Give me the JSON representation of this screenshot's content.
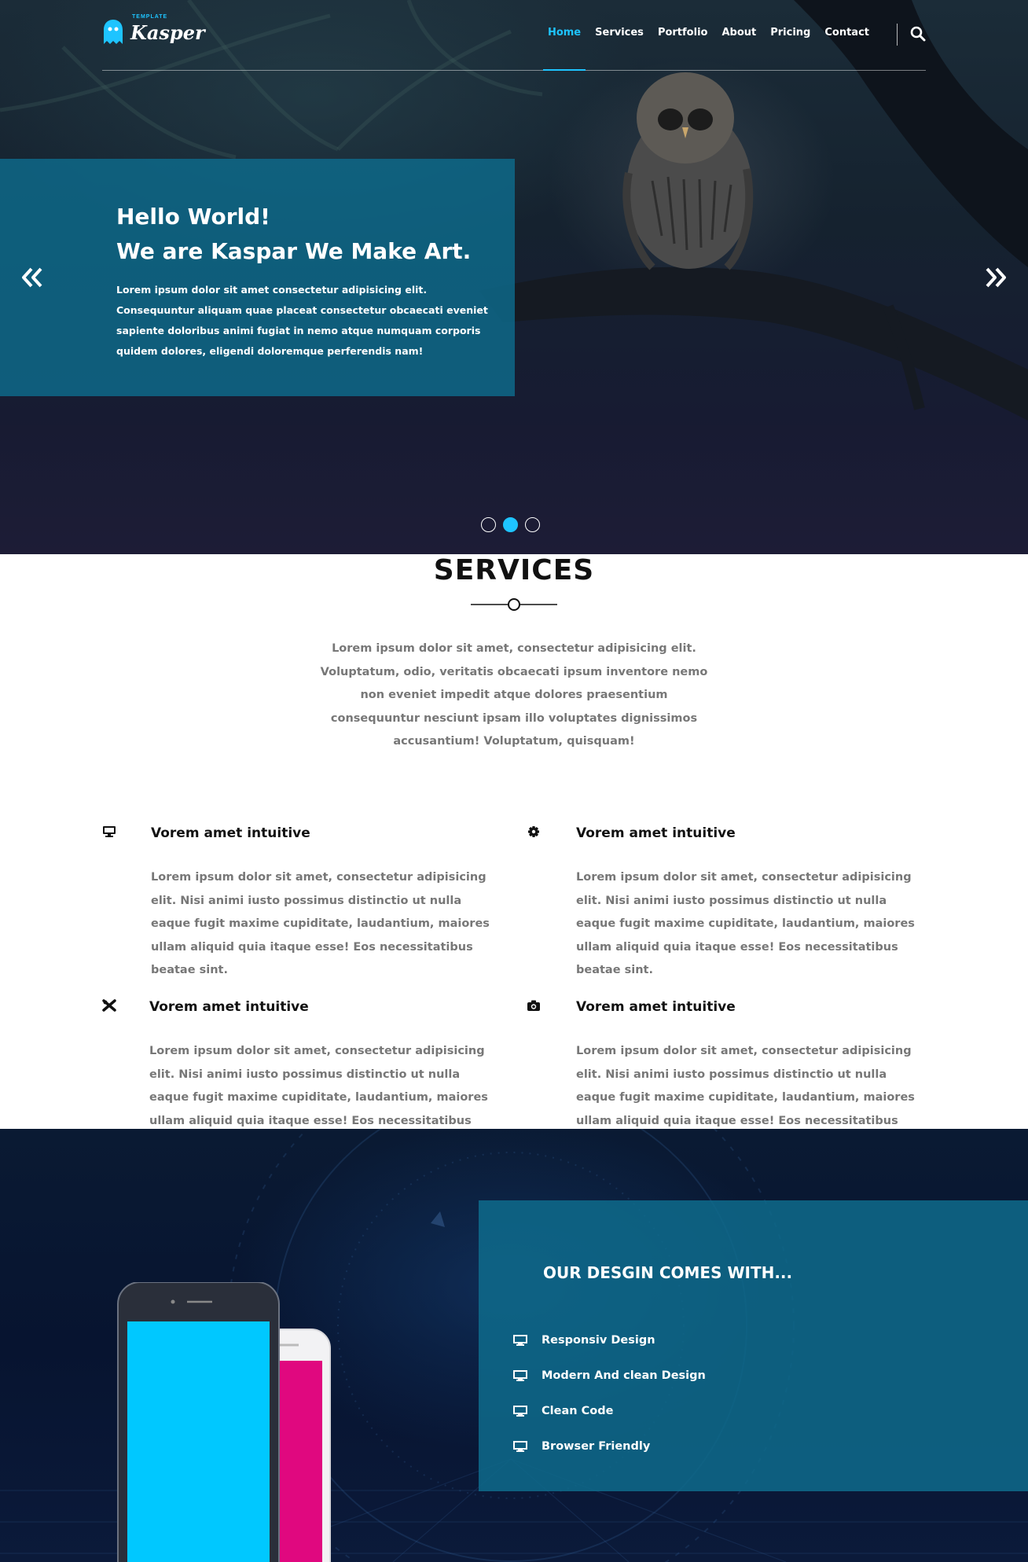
{
  "brand": {
    "name": "Kasper",
    "tag": "TEMPLATE",
    "accent": "#1ec4ff"
  },
  "nav": {
    "items": [
      "Home",
      "Services",
      "Portfolio",
      "About",
      "Pricing",
      "Contact"
    ],
    "active": "Home",
    "search_icon": "search-icon"
  },
  "hero": {
    "title_line1": "Hello World!",
    "title_line2": "We are Kaspar We Make Art.",
    "text": "Lorem ipsum dolor sit amet consectetur adipisicing elit. Consequuntur aliquam quae placeat consectetur obcaecati eveniet sapiente doloribus animi fugiat in nemo atque numquam corporis quidem dolores, eligendi doloremque perferendis nam!",
    "slides": 3,
    "active_slide": 2,
    "prev_icon": "double-chevron-left-icon",
    "next_icon": "double-chevron-right-icon"
  },
  "services": {
    "title": "SERVICES",
    "intro": "Lorem ipsum dolor sit amet, consectetur adipisicing elit. Voluptatum, odio, veritatis obcaecati ipsum inventore nemo non eveniet impedit atque dolores praesentium consequuntur nesciunt ipsam illo voluptates dignissimos accusantium! Voluptatum, quisquam!",
    "items": [
      {
        "icon": "desktop-icon",
        "title": "Vorem amet intuitive",
        "text": "Lorem ipsum dolor sit amet, consectetur adipisicing elit. Nisi animi iusto possimus distinctio ut nulla eaque fugit maxime cupiditate, laudantium, maiores ullam aliquid quia itaque esse! Eos necessitatibus beatae sint."
      },
      {
        "icon": "gear-icon",
        "title": "Vorem amet intuitive",
        "text": "Lorem ipsum dolor sit amet, consectetur adipisicing elit. Nisi animi iusto possimus distinctio ut nulla eaque fugit maxime cupiditate, laudantium, maiores ullam aliquid quia itaque esse! Eos necessitatibus beatae sint."
      },
      {
        "icon": "design-tools-icon",
        "title": "Vorem amet intuitive",
        "text": "Lorem ipsum dolor sit amet, consectetur adipisicing elit. Nisi animi iusto possimus distinctio ut nulla eaque fugit maxime cupiditate, laudantium, maiores ullam aliquid quia itaque esse! Eos necessitatibus beatae sint."
      },
      {
        "icon": "camera-icon",
        "title": "Vorem amet intuitive",
        "text": "Lorem ipsum dolor sit amet, consectetur adipisicing elit. Nisi animi iusto possimus distinctio ut nulla eaque fugit maxime cupiditate, laudantium, maiores ullam aliquid quia itaque esse! Eos necessitatibus beatae sint."
      }
    ]
  },
  "design": {
    "title": "OUR DESGIN COMES WITH...",
    "features": [
      "Responsiv Design",
      "Modern And clean Design",
      "Clean Code",
      "Browser Friendly"
    ],
    "feature_icon": "desktop-icon",
    "phone_colors": {
      "dark_phone_screen": "#00c8ff",
      "light_phone_screen": "#e0087f"
    }
  }
}
